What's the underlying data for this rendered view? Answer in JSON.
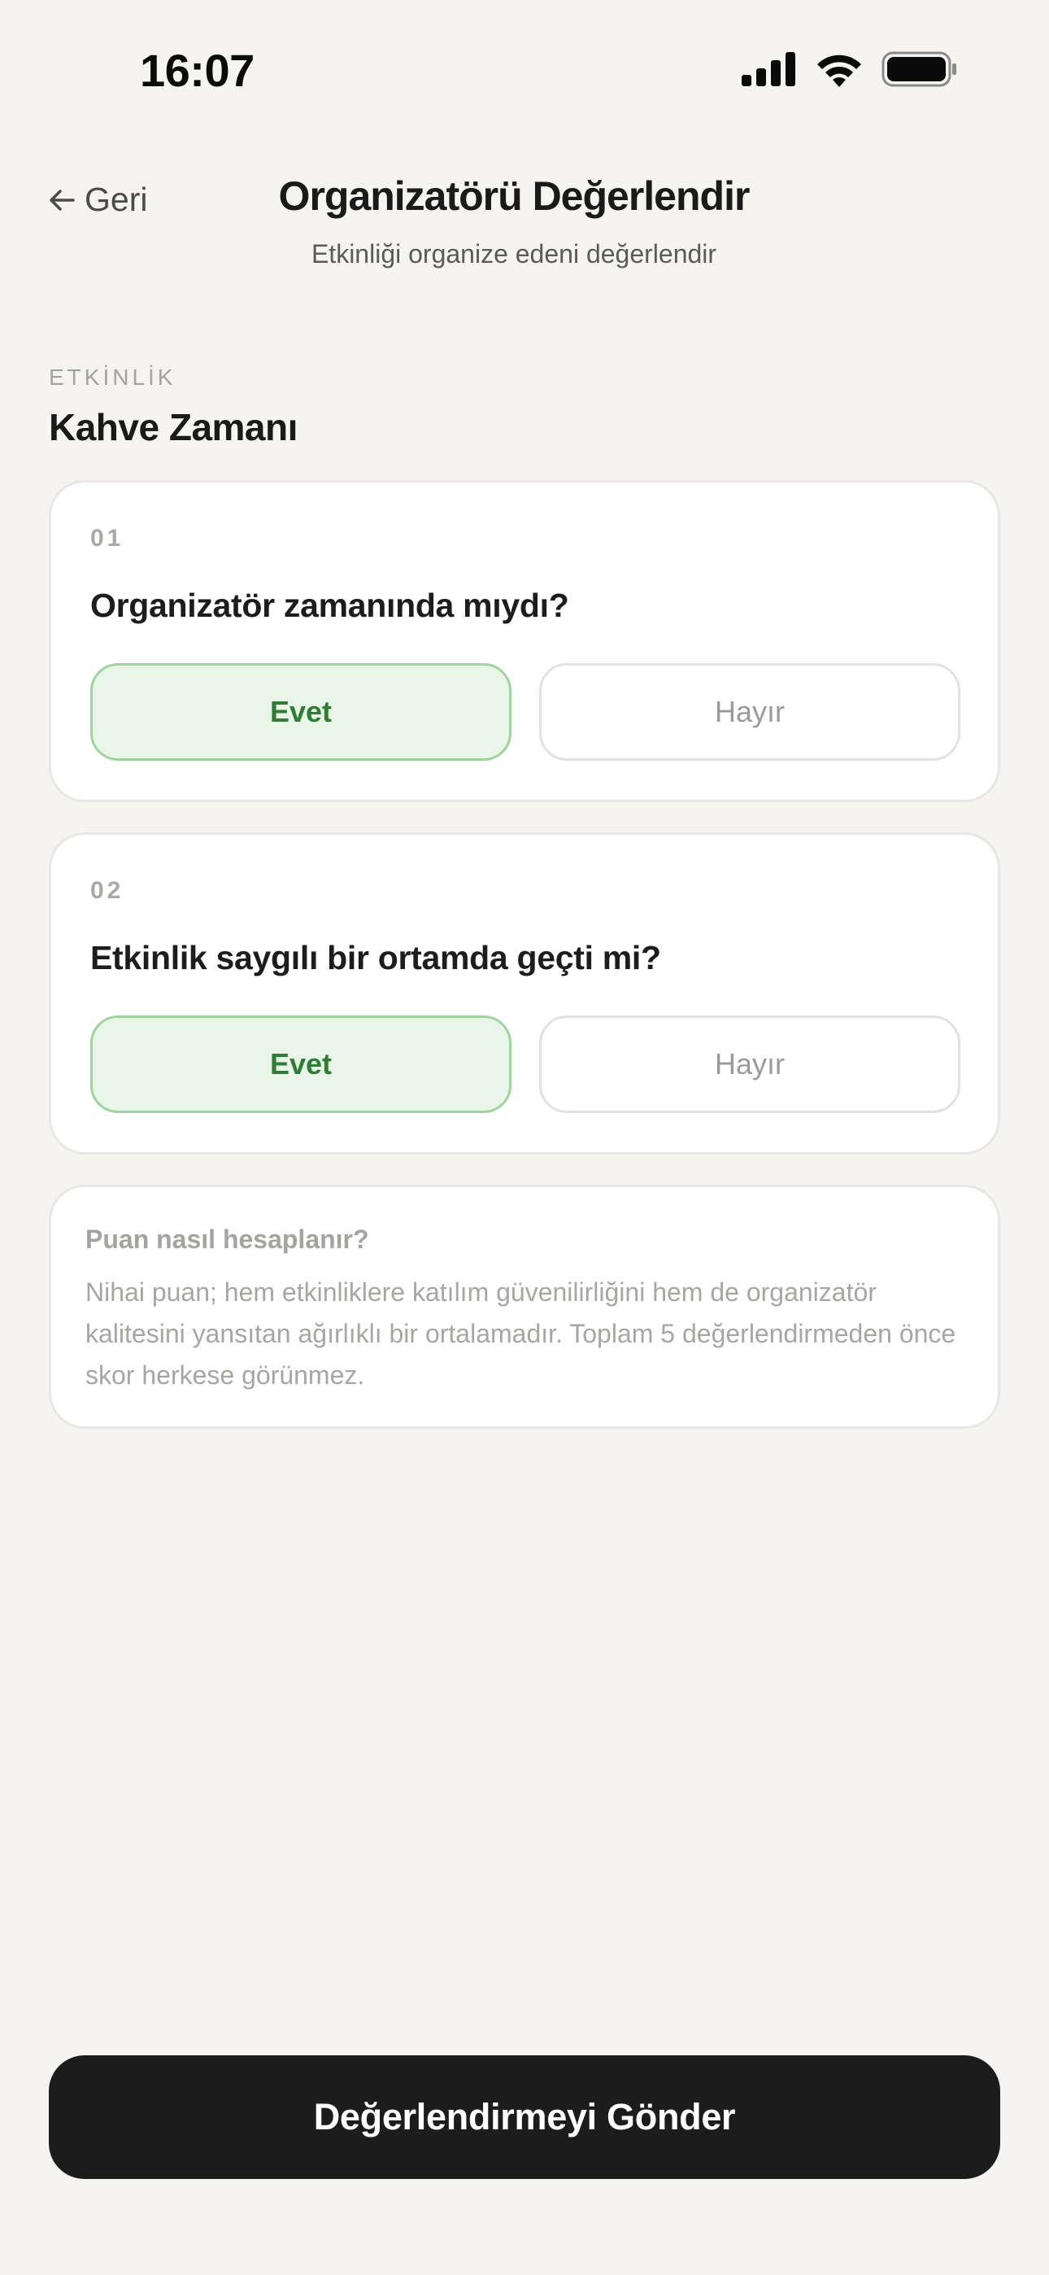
{
  "status_bar": {
    "time": "16:07",
    "icons": [
      "signal-icon",
      "wifi-icon",
      "battery-icon"
    ]
  },
  "header": {
    "back_label": "Geri",
    "title": "Organizatörü Değerlendir",
    "subtitle": "Etkinliği organize edeni değerlendir"
  },
  "event": {
    "label": "ETKİNLİK",
    "name": "Kahve Zamanı"
  },
  "questions": [
    {
      "number": "01",
      "text": "Organizatör zamanında mıydı?",
      "yes_label": "Evet",
      "no_label": "Hayır",
      "selected": "yes"
    },
    {
      "number": "02",
      "text": "Etkinlik saygılı bir ortamda geçti mi?",
      "yes_label": "Evet",
      "no_label": "Hayır",
      "selected": "yes"
    }
  ],
  "info": {
    "title": "Puan nasıl hesaplanır?",
    "body": "Nihai puan; hem etkinliklere katılım güvenilirliğini hem de organizatör kalitesini yansıtan ağırlıklı bir ortalamadır. Toplam 5 değerlendirmeden önce skor herkese görünmez."
  },
  "submit_label": "Değerlendirmeyi Gönder",
  "colors": {
    "background": "#f5f4f0",
    "selected_bg": "#e8f5e8",
    "selected_border": "#9fd49d",
    "selected_text": "#2e7d32",
    "button_dark": "#1c1c1c"
  }
}
